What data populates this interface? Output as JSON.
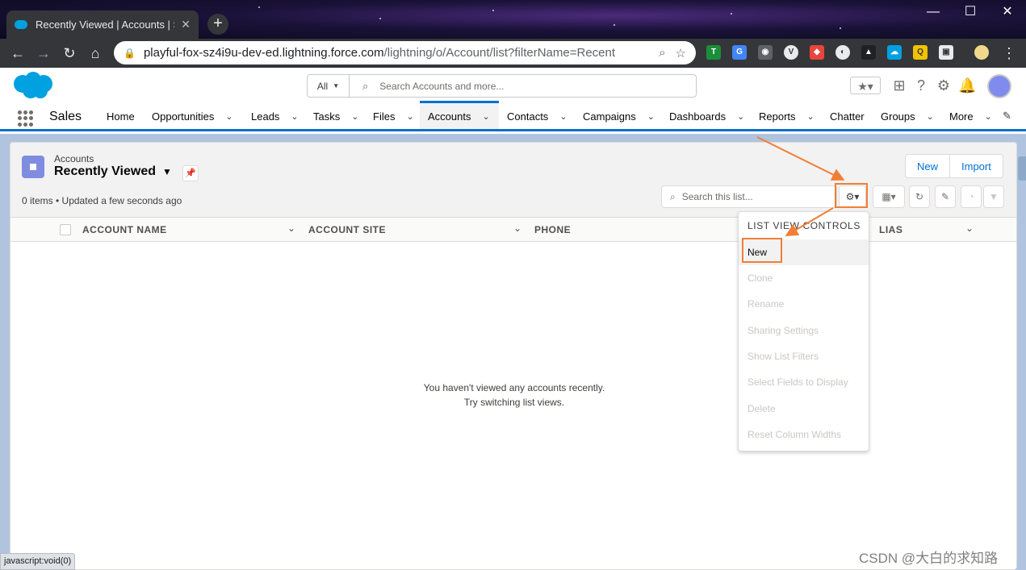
{
  "browser": {
    "tab_title": "Recently Viewed | Accounts | S",
    "url_host": "playful-fox-sz4i9u-dev-ed.lightning.force.com",
    "url_path": "/lightning/o/Account/list?filterName=Recent",
    "status_text": "javascript:void(0)"
  },
  "header": {
    "search_scope": "All",
    "search_placeholder": "Search Accounts and more..."
  },
  "nav": {
    "app_name": "Sales",
    "items": [
      {
        "label": "Home"
      },
      {
        "label": "Opportunities"
      },
      {
        "label": "Leads"
      },
      {
        "label": "Tasks"
      },
      {
        "label": "Files"
      },
      {
        "label": "Accounts"
      },
      {
        "label": "Contacts"
      },
      {
        "label": "Campaigns"
      },
      {
        "label": "Dashboards"
      },
      {
        "label": "Reports"
      },
      {
        "label": "Chatter"
      },
      {
        "label": "Groups"
      },
      {
        "label": "More"
      }
    ]
  },
  "list": {
    "object_label": "Accounts",
    "view_name": "Recently Viewed",
    "meta": "0 items • Updated a few seconds ago",
    "new_button": "New",
    "import_button": "Import",
    "search_placeholder": "Search this list...",
    "columns": [
      "ACCOUNT NAME",
      "ACCOUNT SITE",
      "PHONE",
      "LIAS"
    ],
    "empty_line1": "You haven't viewed any accounts recently.",
    "empty_line2": "Try switching list views."
  },
  "menu": {
    "heading": "LIST VIEW CONTROLS",
    "items": [
      {
        "label": "New",
        "enabled": true
      },
      {
        "label": "Clone",
        "enabled": false
      },
      {
        "label": "Rename",
        "enabled": false
      },
      {
        "label": "Sharing Settings",
        "enabled": false
      },
      {
        "label": "Show List Filters",
        "enabled": false
      },
      {
        "label": "Select Fields to Display",
        "enabled": false
      },
      {
        "label": "Delete",
        "enabled": false
      },
      {
        "label": "Reset Column Widths",
        "enabled": false
      }
    ]
  },
  "watermark": "CSDN @大白的求知路",
  "colors": {
    "brand_blue": "#0070d2",
    "highlight_orange": "#f07f35",
    "salesforce_cloud": "#00a1e0"
  }
}
